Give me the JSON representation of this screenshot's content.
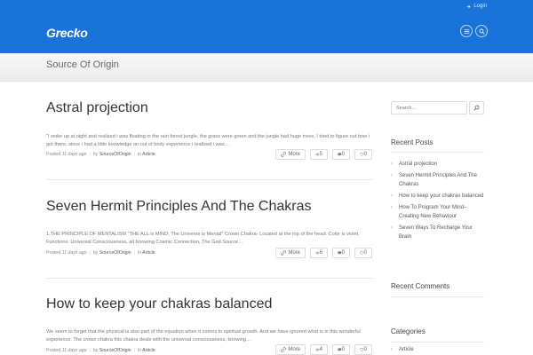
{
  "header": {
    "logo": "Grecko",
    "login_label": "Login",
    "accent_color": "#1a73d8",
    "menu_icon": "menu-icon",
    "search_icon": "search-icon"
  },
  "page": {
    "title": "Source Of Origin"
  },
  "posts": [
    {
      "title": "Astral projection",
      "excerpt": "\"I woke up at night and realized i was floating in the rain forest jungle, the grass were green and the jungle had huge trees, I tried to figure out how i got there, since i had a little knowledge on out of body experience i realized i was…",
      "posted_prefix": "Posted",
      "date": "11 days ago",
      "by_prefix": "by",
      "author": "SourceOfOrigin",
      "in_prefix": "in",
      "category": "Article",
      "more_label": "More",
      "views": "5",
      "comments": "0",
      "likes": "0"
    },
    {
      "title": "Seven Hermit Principles And The Chakras",
      "excerpt": "1.THE PRINCIPLE OF MENTALISM   \"THE ALL is MIND; The Universe is Mental\" Crown Chakra- Located at the top of the head.   Color is violet.   Functions: Universal Consciousness, all Knowing Cosmic Connection, The God Source…",
      "posted_prefix": "Posted",
      "date": "11 days ago",
      "by_prefix": "by",
      "author": "SourceOfOrigin",
      "in_prefix": "in",
      "category": "Article",
      "more_label": "More",
      "views": "6",
      "comments": "0",
      "likes": "0"
    },
    {
      "title": "How to keep your chakras balanced",
      "excerpt": "We seem to forget that the physical is also part of the equation when it comes to spiritual growth. And we have ignored what is in this wonderful experience. The crown chakra this chakra deals with the universal consciousness, knowing…",
      "posted_prefix": "Posted",
      "date": "11 days ago",
      "by_prefix": "by",
      "author": "SourceOfOrigin",
      "in_prefix": "in",
      "category": "Article",
      "more_label": "More",
      "views": "4",
      "comments": "0",
      "likes": "0"
    }
  ],
  "sidebar": {
    "search_placeholder": "Search…",
    "recent_posts_title": "Recent Posts",
    "recent_posts": [
      "Astral projection",
      "Seven Hermit Principles And The Chakras",
      "How to keep your chakras balanced",
      "How To Program Your Mind– Creating New Behaviour",
      "Seven Ways To Recharge Your Brain"
    ],
    "recent_comments_title": "Recent Comments",
    "categories_title": "Categories",
    "categories": [
      "Article"
    ]
  }
}
